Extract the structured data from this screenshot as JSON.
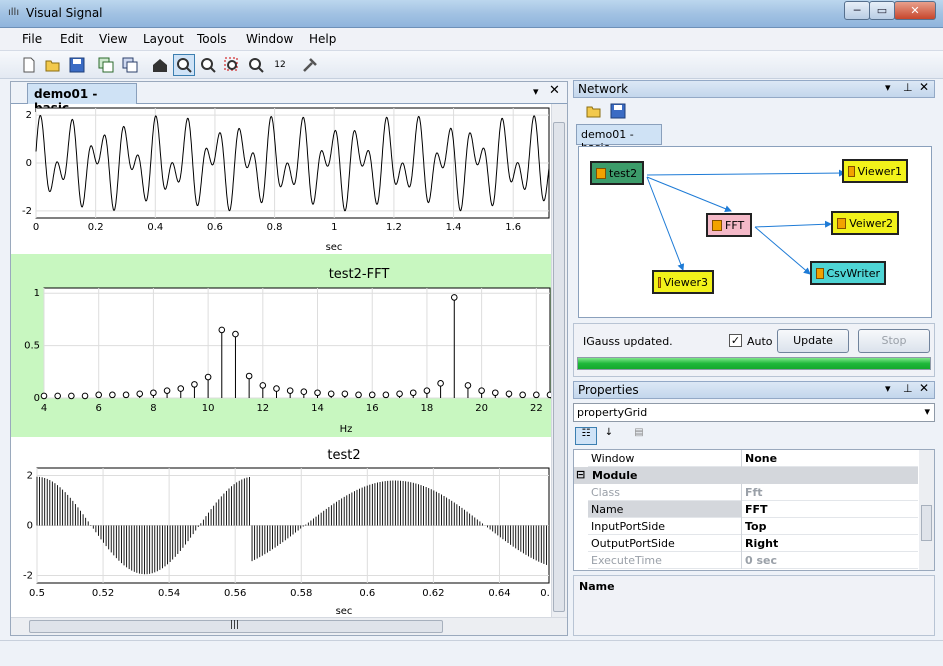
{
  "window": {
    "title": "Visual Signal",
    "app_icon": "waveform-icon",
    "controls": [
      "─",
      "▭",
      "✕"
    ]
  },
  "menu": [
    "File",
    "Edit",
    "View",
    "Layout",
    "Tools",
    "Window",
    "Help"
  ],
  "toolbar": {
    "icons": [
      "new-icon",
      "open-icon",
      "save-icon",
      "copy-image-icon",
      "copy-data-icon",
      "home-icon",
      "zoom-icon",
      "zoom-out-icon",
      "zoom-area-icon",
      "zoom-fit-icon",
      "axis-icon",
      "tools-icon"
    ],
    "zoom_fit_label": "12"
  },
  "document": {
    "tab": "demo01 - basic",
    "pin": "▾",
    "close": "✕",
    "hscroll_grip": "|||"
  },
  "plot1": {
    "xlabel": "sec",
    "x_ticks": [
      "0",
      "0.2",
      "0.4",
      "0.6",
      "0.8",
      "1",
      "1.2",
      "1.4",
      "1.6"
    ],
    "y_ticks": [
      "2",
      "0",
      "-2"
    ]
  },
  "plot2": {
    "title": "test2-FFT",
    "xlabel": "Hz",
    "x_ticks": [
      "4",
      "6",
      "8",
      "10",
      "12",
      "14",
      "16",
      "18",
      "20",
      "22"
    ],
    "y_ticks": [
      "1",
      "0.5",
      "0"
    ]
  },
  "plot3": {
    "title": "test2",
    "xlabel": "sec",
    "x_ticks": [
      "0.5",
      "0.52",
      "0.54",
      "0.56",
      "0.58",
      "0.6",
      "0.62",
      "0.64",
      "0."
    ],
    "y_ticks": [
      "2",
      "0",
      "-2"
    ]
  },
  "chart_data": [
    {
      "type": "line",
      "title": "",
      "xlabel": "sec",
      "ylabel": "",
      "xlim": [
        0,
        1.72
      ],
      "ylim": [
        -2.3,
        2.3
      ],
      "series": [
        {
          "values_desc": "sum of sinusoids ~10Hz and ~18Hz"
        }
      ]
    },
    {
      "type": "scatter",
      "title": "test2-FFT",
      "xlabel": "Hz",
      "ylabel": "",
      "xlim": [
        4,
        22.5
      ],
      "ylim": [
        0,
        1.05
      ],
      "x": [
        4.0,
        4.5,
        5.0,
        5.5,
        6.0,
        6.5,
        7.0,
        7.5,
        8.0,
        8.5,
        9.0,
        9.5,
        10.0,
        10.5,
        11.0,
        11.5,
        12.0,
        12.5,
        13.0,
        13.5,
        14.0,
        14.5,
        15.0,
        15.5,
        16.0,
        16.5,
        17.0,
        17.5,
        18.0,
        18.5,
        19.0,
        19.5,
        20.0,
        20.5,
        21.0,
        21.5,
        22.0,
        22.5
      ],
      "y": [
        0.02,
        0.02,
        0.02,
        0.02,
        0.03,
        0.03,
        0.03,
        0.04,
        0.05,
        0.07,
        0.09,
        0.13,
        0.2,
        0.65,
        0.61,
        0.21,
        0.12,
        0.09,
        0.07,
        0.06,
        0.05,
        0.04,
        0.04,
        0.03,
        0.03,
        0.03,
        0.04,
        0.05,
        0.07,
        0.14,
        0.96,
        0.12,
        0.07,
        0.05,
        0.04,
        0.03,
        0.03,
        0.03
      ]
    },
    {
      "type": "bar",
      "title": "test2",
      "xlabel": "sec",
      "ylabel": "",
      "xlim": [
        0.5,
        0.655
      ],
      "ylim": [
        -2.3,
        2.3
      ],
      "series": [
        {
          "values_desc": "stem/vertical lines, amplitude-modulated signal"
        }
      ]
    }
  ],
  "network": {
    "title": "Network",
    "icons": [
      "open-icon",
      "save-icon"
    ],
    "tab": "demo01 - basic",
    "nodes": [
      {
        "label": "test2",
        "color": "#3c9c6a"
      },
      {
        "label": "Viewer1",
        "color": "#f2f21a"
      },
      {
        "label": "FFT",
        "color": "#f4b9c8"
      },
      {
        "label": "Veiwer2",
        "color": "#f2f21a"
      },
      {
        "label": "CsvWriter",
        "color": "#4ed4d4"
      },
      {
        "label": "Viewer3",
        "color": "#f2f21a"
      }
    ]
  },
  "status": {
    "message": "IGauss updated.",
    "auto_label": "Auto",
    "auto_checked": true,
    "update_btn": "Update",
    "stop_btn": "Stop",
    "progress": 1.0
  },
  "properties": {
    "title": "Properties",
    "selector": "propertyGrid",
    "rows": [
      {
        "key": "Window",
        "value": "None"
      },
      {
        "key": "Class",
        "value": "Fft",
        "dim": true
      },
      {
        "key": "Name",
        "value": "FFT"
      },
      {
        "key": "InputPortSide",
        "value": "Top"
      },
      {
        "key": "OutputPortSide",
        "value": "Right"
      },
      {
        "key": "ExecuteTime",
        "value": "0 sec",
        "dim": true
      }
    ],
    "category": "Module",
    "collapse_glyph": "⊟",
    "description_title": "Name"
  },
  "colors": {
    "accent": "#3c7fb1",
    "plot_bg_highlight": "#c8f7c0",
    "progress": "#1fb83a"
  }
}
